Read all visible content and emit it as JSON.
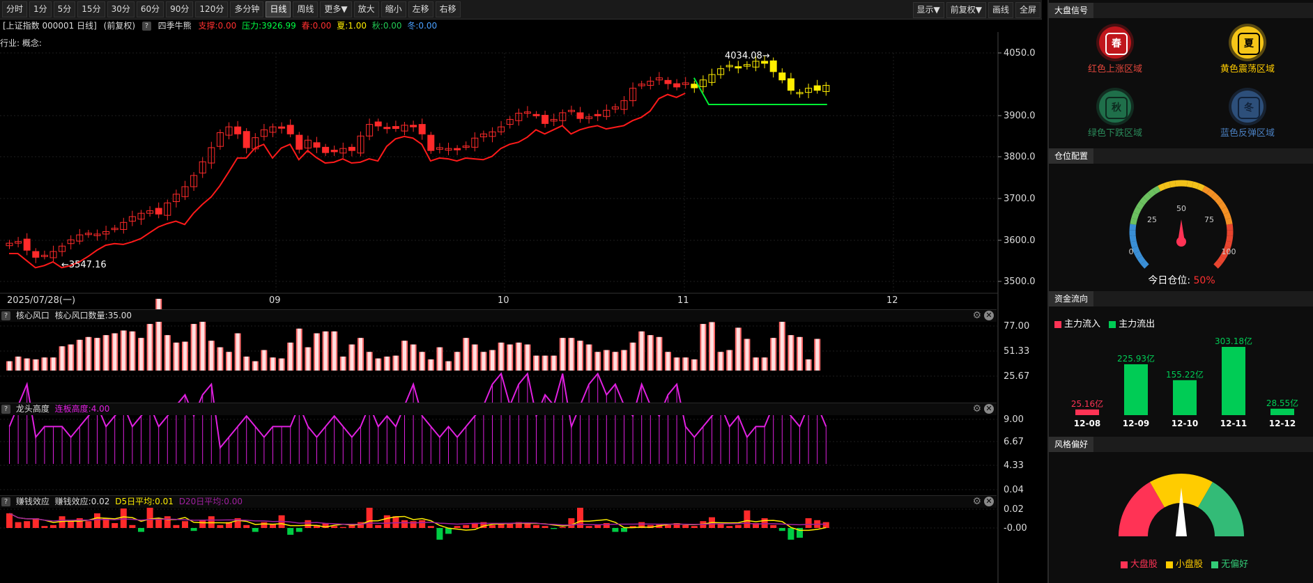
{
  "toolbar": {
    "periods": [
      "分时",
      "1分",
      "5分",
      "15分",
      "30分",
      "60分",
      "90分",
      "120分",
      "多分钟",
      "日线",
      "周线",
      "更多▼",
      "放大",
      "缩小",
      "左移",
      "右移"
    ],
    "active": "日线",
    "right_buttons": [
      "显示▼",
      "前复权▼",
      "画线",
      "全屏"
    ]
  },
  "info": {
    "title": "[上证指数 000001 日线]",
    "adjust": "(前复权)",
    "q": "?",
    "indicator": "四季牛熊",
    "support": "支撑:0.00",
    "pressure": "压力:3926.99",
    "spring": "春:0.00",
    "summer": "夏:1.00",
    "autumn": "秋:0.00",
    "winter": "冬:0.00"
  },
  "industry": "行业: 概念:",
  "main_chart": {
    "y_ticks": [
      "4050.0",
      "3900.0",
      "3800.0",
      "3700.0",
      "3600.0",
      "3500.0"
    ],
    "high_label": "4034.08",
    "low_label": "3547.16",
    "date_label": "2025/07/28(一)",
    "months": [
      "09",
      "10",
      "11",
      "12"
    ]
  },
  "panel1": {
    "name": "核心风口",
    "value_text": "核心风口数量:35.00",
    "y_ticks": [
      "77.00",
      "51.33",
      "25.67"
    ]
  },
  "panel2": {
    "name": "龙头高度",
    "value_text": "连板高度:4.00",
    "y_ticks": [
      "9.00",
      "6.67",
      "4.33"
    ]
  },
  "panel3": {
    "name": "赚钱效应",
    "value_text": "赚钱效应:0.02",
    "d5": "D5日平均:0.01",
    "d20": "D20日平均:0.00",
    "y_ticks": [
      "0.04",
      "0.02",
      "-0.00"
    ]
  },
  "sidebar": {
    "market_signal": "大盘信号",
    "seasons": [
      {
        "glyph": "春",
        "label": "红色上涨区域",
        "color": "#c0161c"
      },
      {
        "glyph": "夏",
        "label": "黄色震荡区域",
        "color": "#f5c518"
      },
      {
        "glyph": "秋",
        "label": "绿色下跌区域",
        "color": "#1f6f4a"
      },
      {
        "glyph": "冬",
        "label": "蓝色反弹区域",
        "color": "#2d4f7a"
      }
    ],
    "position_title": "仓位配置",
    "gauge_ticks": [
      "0",
      "25",
      "50",
      "75",
      "100"
    ],
    "today_position_label": "今日仓位:",
    "today_position_value": "50%",
    "flow_title": "资金流向",
    "flow_in_label": "主力流入",
    "flow_out_label": "主力流出",
    "style_title": "风格偏好",
    "style_legend": [
      "大盘股",
      "小盘股",
      "无偏好"
    ]
  },
  "flow_data": {
    "type": "bar",
    "categories": [
      "12-08",
      "12-09",
      "12-10",
      "12-11",
      "12-12"
    ],
    "values": [
      25.16,
      225.93,
      155.22,
      303.18,
      28.55
    ],
    "value_labels": [
      "25.16亿",
      "225.93亿",
      "155.22亿",
      "303.18亿",
      "28.55亿"
    ],
    "direction": [
      "in",
      "out",
      "out",
      "out",
      "out"
    ]
  },
  "colors": {
    "up": "#ff2a2a",
    "down": "#00cc44",
    "yellow": "#ffee00",
    "magenta": "#e020e0",
    "axis": "#555555"
  }
}
